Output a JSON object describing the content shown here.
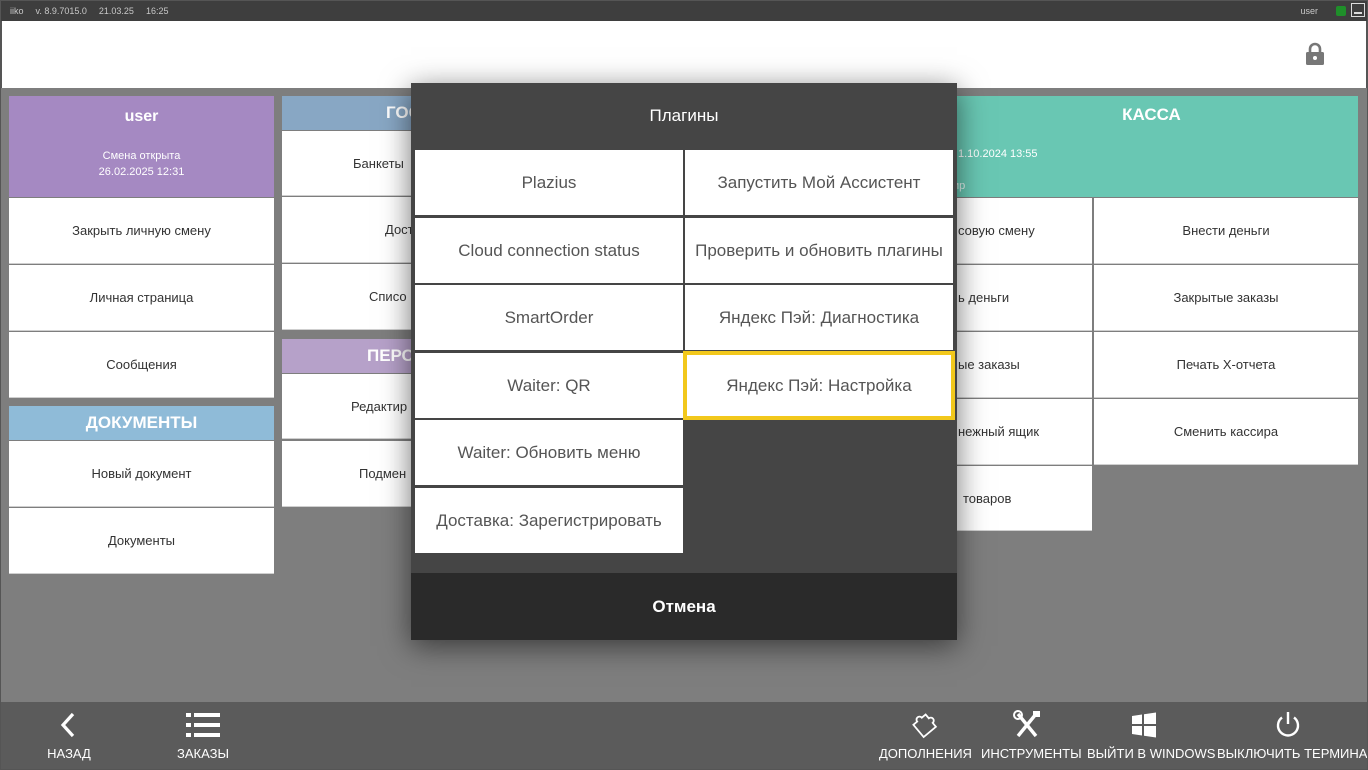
{
  "titlebar": {
    "app": "iiko",
    "version": "v. 8.9.7015.0",
    "date": "21.03.25",
    "time": "16:25",
    "user": "user"
  },
  "user_panel": {
    "name": "user",
    "status": "Смена открыта",
    "opened_at": "26.02.2025 12:31",
    "tiles": [
      "Закрыть личную смену",
      "Личная страница",
      "Сообщения"
    ]
  },
  "documents_panel": {
    "title": "ДОКУМЕНТЫ",
    "tiles": [
      "Новый документ",
      "Документы"
    ]
  },
  "guests_panel": {
    "title_visible": "ГОС",
    "tiles_visible": [
      "Банкеты",
      "Дост",
      "Списо"
    ]
  },
  "staff_panel": {
    "title_visible": "ПЕРС",
    "tiles_visible": [
      "Редактир",
      "Подмен"
    ]
  },
  "kassa_panel": {
    "title": "КАССА",
    "date_visible": "1.10.2024 13:55",
    "role_visible": "ир",
    "tiles_col1_visible": [
      "совую смену",
      "ь деньги",
      "ые заказы",
      "нежный ящик",
      "товаров"
    ],
    "tiles_col2": [
      "Внести деньги",
      "Закрытые заказы",
      "Печать X-отчета",
      "Сменить кассира"
    ]
  },
  "modal": {
    "title": "Плагины",
    "buttons_left": [
      "Plazius",
      "Cloud connection status",
      "SmartOrder",
      "Waiter: QR",
      "Waiter: Обновить меню",
      "Доставка: Зарегистрировать"
    ],
    "buttons_right": [
      "Запустить Мой Ассистент",
      "Проверить и обновить плагины",
      "Яндекс Пэй: Диагностика",
      "Яндекс Пэй: Настройка"
    ],
    "selected": "Яндекс Пэй: Настройка",
    "cancel": "Отмена",
    "highlight_color": "#f2c81c"
  },
  "bottombar": {
    "back": "НАЗАД",
    "orders": "ЗАКАЗЫ",
    "addons": "ДОПОЛНЕНИЯ",
    "tools": "ИНСТРУМЕНТЫ",
    "exit_windows": "ВЫЙТИ В WINDOWS",
    "shutdown": "ВЫКЛЮЧИТЬ ТЕРМИНАЛ"
  },
  "icons": {
    "lock": "lock-icon",
    "back": "chevron-left-icon",
    "orders": "list-icon",
    "addons": "puzzle-icon",
    "tools": "tools-icon",
    "windows": "windows-icon",
    "power": "power-icon"
  }
}
